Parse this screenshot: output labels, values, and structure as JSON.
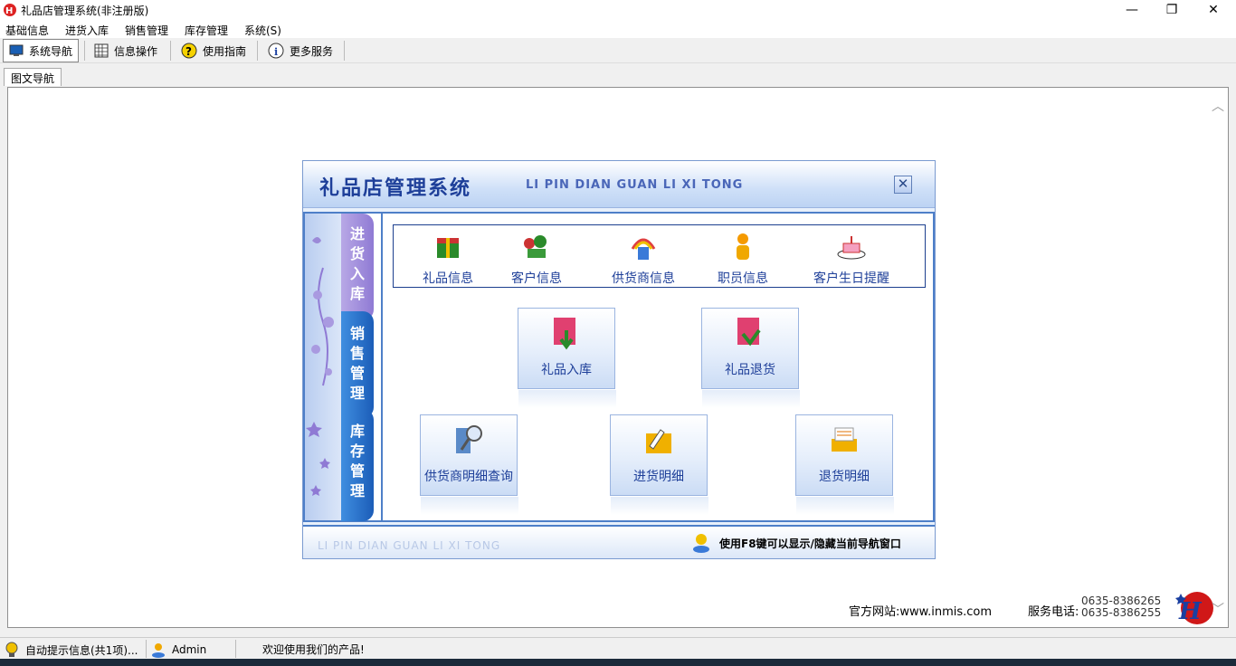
{
  "window": {
    "title": "礼品店管理系统(非注册版)",
    "minimize": "—",
    "maximize": "❐",
    "close": "✕"
  },
  "menu": [
    "基础信息",
    "进货入库",
    "销售管理",
    "库存管理",
    "系统(S)"
  ],
  "toolbar": [
    {
      "label": "系统导航",
      "icon": "monitor-icon"
    },
    {
      "label": "信息操作",
      "icon": "grid-icon"
    },
    {
      "label": "使用指南",
      "icon": "help-icon"
    },
    {
      "label": "更多服务",
      "icon": "info-icon"
    }
  ],
  "tab": "图文导航",
  "panel": {
    "title": "礼品店管理系统",
    "subtitle": "LI PIN DIAN GUAN LI XI TONG",
    "close": "✕",
    "vtabs": [
      "进\n货\n入\n库",
      "销\n售\n管\n理",
      "库\n存\n管\n理"
    ],
    "quick": [
      "礼品信息",
      "客户信息",
      "供货商信息",
      "职员信息",
      "客户生日提醒"
    ],
    "buttons": [
      "礼品入库",
      "礼品退货",
      "供货商明细查询",
      "进货明细",
      "退货明细"
    ],
    "footer_subtitle": "LI PIN DIAN GUAN LI XI TONG",
    "footer_tip": "使用F8键可以显示/隐藏当前导航窗口"
  },
  "site": "官方网站:www.inmis.com",
  "phone_label": "服务电话:",
  "phones": [
    "0635-8386265",
    "0635-8386255"
  ],
  "status": {
    "hint": "自动提示信息(共1项)...",
    "user": "Admin",
    "welcome": "欢迎使用我们的产品!"
  },
  "colors": {
    "accent": "#1e3f99",
    "panel_border": "#4e7fc8",
    "tab_purple": "#8f7ad4",
    "tab_blue": "#1c5db8"
  }
}
